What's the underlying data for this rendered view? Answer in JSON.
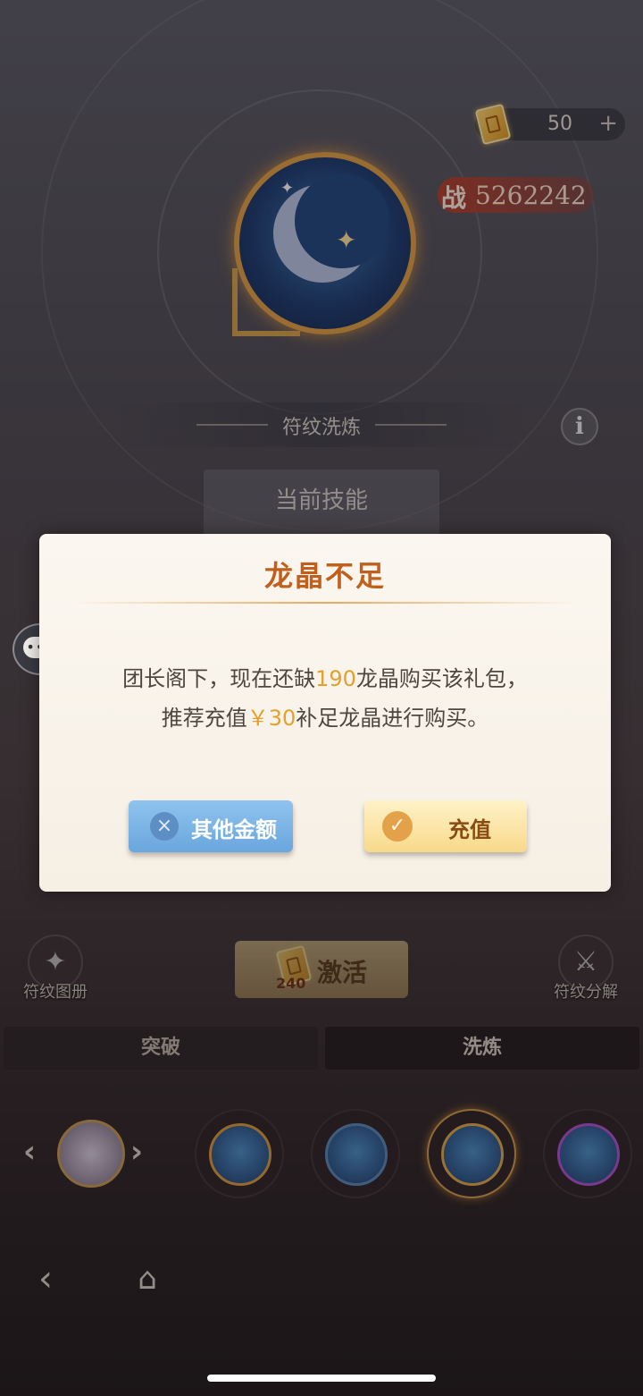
{
  "header": {
    "currency_amount": "50",
    "currency_plus": "+",
    "power_label": "战",
    "power_value": "5262242"
  },
  "rune_panel": {
    "section_title": "符纹洗炼",
    "info_icon": "i",
    "current_skill_label": "当前技能"
  },
  "dialog": {
    "title": "龙晶不足",
    "line1_prefix": "团长阁下，现在还缺",
    "line1_amount": "190",
    "line1_suffix": "龙晶购买该礼包，",
    "line2_prefix": "推荐充值",
    "line2_price": "￥30",
    "line2_suffix": "补足龙晶进行购买。",
    "other_amount_button": "其他金额",
    "recharge_button": "充值",
    "close_icon": "×",
    "check_icon": "✓"
  },
  "lower": {
    "rune_album_label": "符纹图册",
    "rune_decompose_label": "符纹分解",
    "activate_label": "激活",
    "activate_cost": "240",
    "tabs": [
      "突破",
      "洗炼"
    ]
  },
  "icons": {
    "chat": "chat-bubble-icon",
    "back": "back-arrow-icon",
    "home": "home-icon"
  },
  "colors": {
    "dialog_title": "#c0601c",
    "highlight": "#e5a02a",
    "blue_button": "#6aa6dc",
    "gold_button": "#f8d98a"
  }
}
